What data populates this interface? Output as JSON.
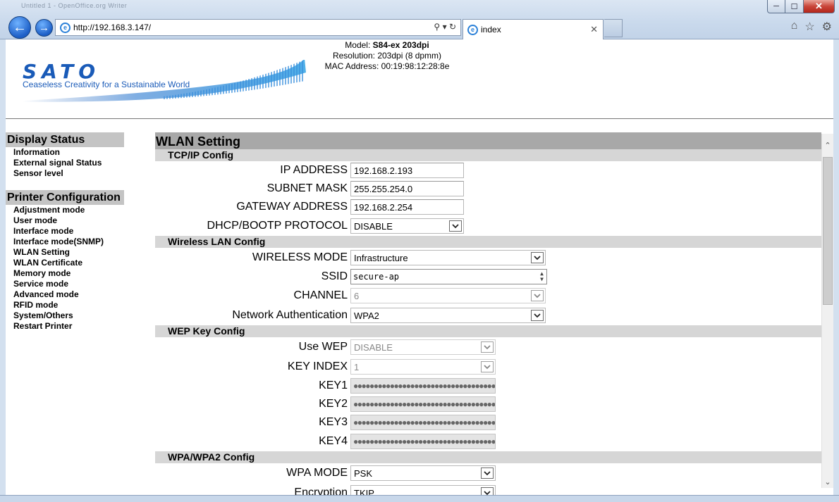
{
  "browser": {
    "address_url": "http://192.168.3.147/",
    "tab_title": "index",
    "ghost_title": "Untitled 1 - OpenOffice.org Writer"
  },
  "header": {
    "logo_text": "SATO",
    "tagline": "Ceaseless Creativity for a Sustainable World",
    "model_label": "Model:",
    "model_value": "S84-ex 203dpi",
    "resolution_label": "Resolution:",
    "resolution_value": "203dpi (8 dpmm)",
    "mac_label": "MAC Address:",
    "mac_value": "00:19:98:12:28:8e"
  },
  "sidebar": {
    "display_status": {
      "title": "Display Status",
      "items": [
        "Information",
        "External signal Status",
        "Sensor level"
      ]
    },
    "printer_config": {
      "title": "Printer Configuration",
      "items": [
        "Adjustment mode",
        "User mode",
        "Interface mode",
        "Interface mode(SNMP)",
        "WLAN Setting",
        "WLAN Certificate",
        "Memory mode",
        "Service mode",
        "Advanced mode",
        "RFID mode",
        "System/Others",
        "Restart Printer"
      ]
    }
  },
  "main": {
    "title": "WLAN Setting",
    "tcpip": {
      "title": "TCP/IP Config",
      "ip_label": "IP ADDRESS",
      "ip_value": "192.168.2.193",
      "subnet_label": "SUBNET MASK",
      "subnet_value": "255.255.254.0",
      "gateway_label": "GATEWAY ADDRESS",
      "gateway_value": "192.168.2.254",
      "dhcp_label": "DHCP/BOOTP PROTOCOL",
      "dhcp_value": "DISABLE"
    },
    "wireless": {
      "title": "Wireless LAN Config",
      "mode_label": "WIRELESS MODE",
      "mode_value": "Infrastructure",
      "ssid_label": "SSID",
      "ssid_value": "secure-ap",
      "channel_label": "CHANNEL",
      "channel_value": "6",
      "auth_label": "Network Authentication",
      "auth_value": "WPA2"
    },
    "wep": {
      "title": "WEP Key Config",
      "use_wep_label": "Use WEP",
      "use_wep_value": "DISABLE",
      "key_index_label": "KEY INDEX",
      "key_index_value": "1",
      "key1_label": "KEY1",
      "key2_label": "KEY2",
      "key3_label": "KEY3",
      "key4_label": "KEY4",
      "key_mask": "●●●●●●●●●●●●●●●●●●●●●●●●●●●●●●●●●●●●●●●●"
    },
    "wpa": {
      "title": "WPA/WPA2 Config",
      "wpa_mode_label": "WPA MODE",
      "wpa_mode_value": "PSK",
      "encryption_label": "Encryption",
      "encryption_value": "TKIP"
    }
  },
  "colors": {
    "brand_blue": "#1a5bb8",
    "title_bar": "#a8a8a8",
    "section_bar": "#d6d6d6"
  }
}
